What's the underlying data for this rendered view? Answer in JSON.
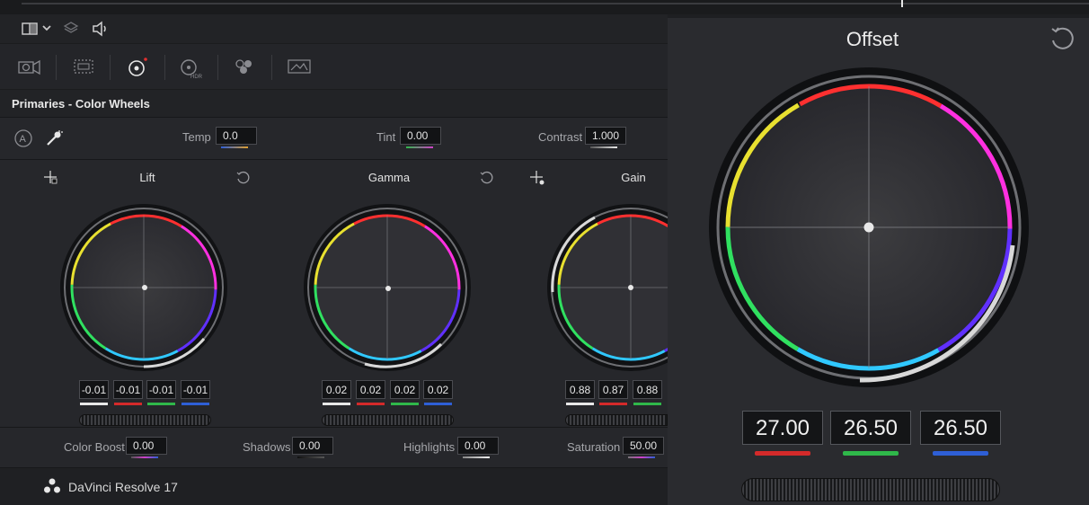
{
  "toolbar": {
    "icons": [
      "viewer-layout-icon",
      "chevron-down-icon",
      "layers-icon",
      "speaker-icon"
    ]
  },
  "palette_tabs": [
    "camera-raw-icon",
    "color-match-icon",
    "color-wheels-icon",
    "hdr-wheels-icon",
    "rgb-mixer-icon",
    "motion-effects-icon"
  ],
  "panel": {
    "title": "Primaries - Color Wheels"
  },
  "adjustments": {
    "temp": {
      "label": "Temp",
      "value": "0.0"
    },
    "tint": {
      "label": "Tint",
      "value": "0.00"
    },
    "contrast": {
      "label": "Contrast",
      "value": "1.000"
    }
  },
  "wheels": {
    "lift": {
      "title": "Lift",
      "values": [
        "-0.01",
        "-0.01",
        "-0.01",
        "-0.01"
      ]
    },
    "gamma": {
      "title": "Gamma",
      "values": [
        "0.02",
        "0.02",
        "0.02",
        "0.02"
      ]
    },
    "gain": {
      "title": "Gain",
      "values": [
        "0.88",
        "0.87",
        "0.88"
      ]
    }
  },
  "bottom": {
    "color_boost": {
      "label": "Color Boost",
      "value": "0.00"
    },
    "shadows": {
      "label": "Shadows",
      "value": "0.00"
    },
    "highlights": {
      "label": "Highlights",
      "value": "0.00"
    },
    "saturation": {
      "label": "Saturation",
      "value": "50.00"
    }
  },
  "status": {
    "app_name": "DaVinci Resolve 17"
  },
  "offset": {
    "title": "Offset",
    "values": [
      "27.00",
      "26.50",
      "26.50"
    ]
  },
  "colors": {
    "red": "#d42a2a",
    "green": "#2fb84a",
    "blue": "#2e5fd6",
    "white": "#e8e8e8"
  }
}
